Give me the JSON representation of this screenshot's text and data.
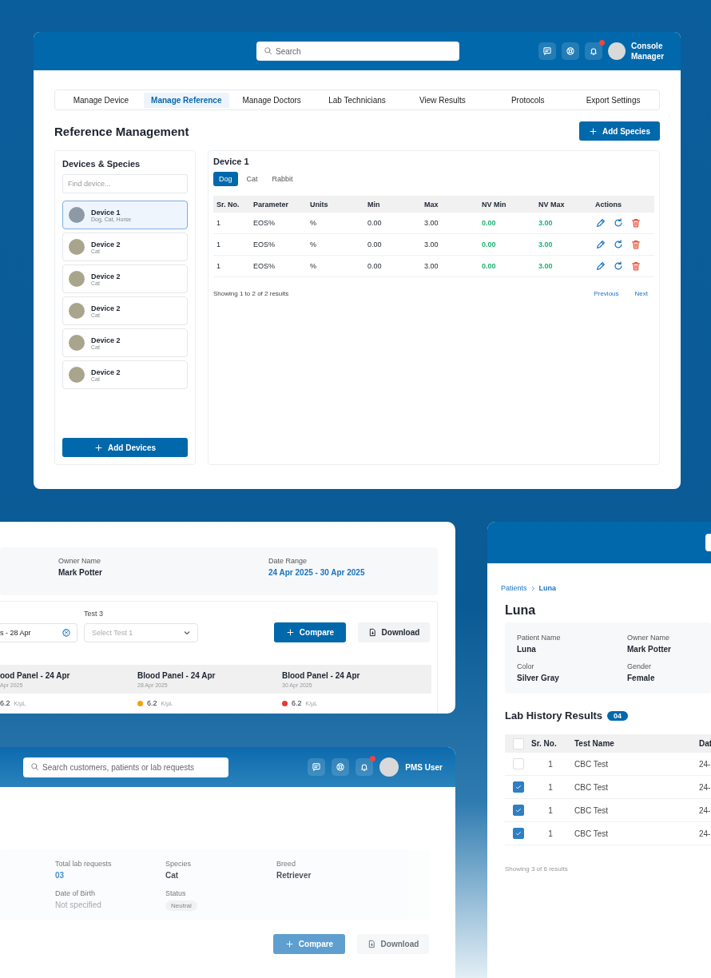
{
  "main_window": {
    "header": {
      "search_placeholder": "Search",
      "notification": true,
      "user_name": "Console Manager"
    },
    "tabs": [
      {
        "label": "Manage Device",
        "selected": false
      },
      {
        "label": "Manage Reference",
        "selected": true
      },
      {
        "label": "Manage Doctors",
        "selected": false
      },
      {
        "label": "Lab Technicians",
        "selected": false
      },
      {
        "label": "View Results",
        "selected": false
      },
      {
        "label": "Protocols",
        "selected": false
      },
      {
        "label": "Export Settings",
        "selected": false
      }
    ],
    "title": "Reference Management",
    "add_button": "Add Species",
    "devices": {
      "title": "Devices & Species",
      "search_placeholder": "Find device...",
      "items": [
        {
          "name": "Device 1",
          "species": "Dog, Cat, Horse",
          "selected": true
        },
        {
          "name": "Device 2",
          "species": "Cat",
          "selected": false
        },
        {
          "name": "Device 2",
          "species": "Cat",
          "selected": false
        },
        {
          "name": "Device 2",
          "species": "Cat",
          "selected": false
        },
        {
          "name": "Device 2",
          "species": "Cat",
          "selected": false
        },
        {
          "name": "Device 2",
          "species": "Cat",
          "selected": false
        }
      ],
      "add_button": "Add Devices"
    },
    "detail": {
      "title": "Device 1",
      "species_tabs": [
        {
          "label": "Dog",
          "selected": true
        },
        {
          "label": "Cat",
          "selected": false
        },
        {
          "label": "Rabbit",
          "selected": false
        }
      ],
      "columns": [
        "Sr. No.",
        "Parameter",
        "Units",
        "Min",
        "Max",
        "NV Min",
        "NV Max",
        "Actions"
      ],
      "rows": [
        {
          "cells": [
            "1",
            "EOS%",
            "%",
            "0.00",
            "3.00",
            "0.00",
            "3.00"
          ]
        },
        {
          "cells": [
            "1",
            "EOS%",
            "%",
            "0.00",
            "3.00",
            "0.00",
            "3.00"
          ]
        },
        {
          "cells": [
            "1",
            "EOS%",
            "%",
            "0.00",
            "3.00",
            "0.00",
            "3.00"
          ]
        }
      ],
      "summary": "Showing 1 to 2 of 2 results",
      "pagination": [
        "Previous",
        "Next"
      ]
    }
  },
  "comparison_window": {
    "info": [
      {
        "label": "Owner Name",
        "value": "Mark Potter",
        "kind": "text"
      },
      {
        "label": "Date Range",
        "value": "24 Apr 2025 - 30 Apr 2025",
        "kind": "accent"
      }
    ],
    "test_fields": [
      {
        "kind": "input",
        "value": "s - 28 Apr"
      },
      {
        "kind": "select",
        "label": "Test 3",
        "placeholder": "Select Test 1"
      }
    ],
    "compare_button": "Compare",
    "download_button": "Download",
    "results": [
      {
        "title": "ood Panel - 24 Apr",
        "date": "Apr 2025",
        "value": "6.2",
        "unit": "K/µL"
      },
      {
        "title": "Blood Panel - 24 Apr",
        "date": "28 Apr 2025",
        "value": "6.2",
        "unit": "K/µL",
        "color": "#f5a00f"
      },
      {
        "title": "Blood Panel - 24 Apr",
        "date": "30 Apr 2025",
        "value": "6.2",
        "unit": "K/µL",
        "color": "#e53935"
      }
    ]
  },
  "patient_window": {
    "header": {
      "search_placeholder": "Search customers, patients or lab requests",
      "notification": true,
      "user_name": "PMS User"
    },
    "info": [
      {
        "label": "Total lab requests",
        "value": "03",
        "kind": "accent"
      },
      {
        "label": "Species",
        "value": "Cat",
        "kind": "text"
      },
      {
        "label": "Breed",
        "value": "Retriever",
        "kind": "text"
      },
      {
        "label": "Date of Birth",
        "value": "Not specified",
        "kind": "muted"
      },
      {
        "label": "Status",
        "value": "Neutral",
        "kind": "badge"
      }
    ],
    "compare_button": "Compare",
    "download_button": "Download"
  },
  "lab_history_window": {
    "breadcrumb": [
      {
        "label": "Patients",
        "current": false
      },
      {
        "label": "Luna",
        "current": true
      }
    ],
    "title": "Luna",
    "info": [
      {
        "label": "Patient Name",
        "value": "Luna"
      },
      {
        "label": "Owner Name",
        "value": "Mark Potter"
      },
      {
        "label": "Color",
        "value": "Silver Gray"
      },
      {
        "label": "Gender",
        "value": "Female"
      }
    ],
    "section_title": "Lab History Results",
    "count": "04",
    "columns": [
      "Sr. No.",
      "Test Name",
      "Dat"
    ],
    "select_all_checked": false,
    "rows": [
      {
        "checked": false,
        "sr": "1",
        "test": "CBC Test",
        "date": "24-"
      },
      {
        "checked": true,
        "sr": "1",
        "test": "CBC Test",
        "date": "24-"
      },
      {
        "checked": true,
        "sr": "1",
        "test": "CBC Test",
        "date": "24-"
      },
      {
        "checked": true,
        "sr": "1",
        "test": "CBC Test",
        "date": "24-"
      }
    ],
    "summary": "Showing 3 of 6 results"
  }
}
